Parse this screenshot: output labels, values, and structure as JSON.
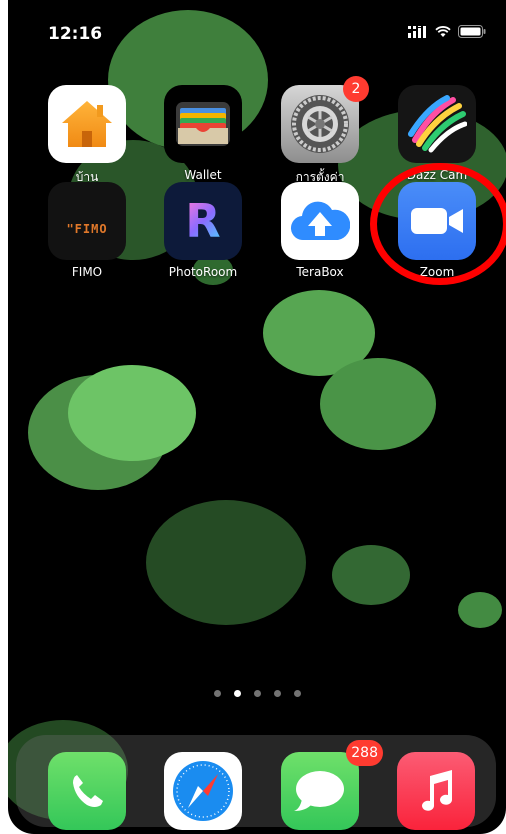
{
  "status_bar": {
    "time": "12:16"
  },
  "apps": [
    {
      "id": "home",
      "label": "บ้าน",
      "icon": "home-icon"
    },
    {
      "id": "wallet",
      "label": "Wallet",
      "icon": "wallet-icon"
    },
    {
      "id": "settings",
      "label": "การตั้งค่า",
      "icon": "settings-gear-icon",
      "badge": "2"
    },
    {
      "id": "dazzcam",
      "label": "Dazz Cam",
      "icon": "dazz-cam-icon"
    },
    {
      "id": "fimo",
      "label": "FIMO",
      "icon": "fimo-icon",
      "icon_text": "\"FIMO"
    },
    {
      "id": "photoroom",
      "label": "PhotoRoom",
      "icon": "photoroom-icon",
      "icon_text": "R"
    },
    {
      "id": "terabox",
      "label": "TeraBox",
      "icon": "terabox-cloud-icon"
    },
    {
      "id": "zoom",
      "label": "Zoom",
      "icon": "zoom-video-icon"
    }
  ],
  "page_dots": {
    "count": 5,
    "active_index": 1
  },
  "dock": [
    {
      "id": "phone",
      "icon": "phone-icon"
    },
    {
      "id": "safari",
      "icon": "safari-compass-icon"
    },
    {
      "id": "messages",
      "icon": "messages-icon",
      "badge": "288"
    },
    {
      "id": "music",
      "icon": "music-note-icon"
    }
  ],
  "annotation": {
    "highlighted_app": "zoom",
    "color": "#ff0000"
  }
}
